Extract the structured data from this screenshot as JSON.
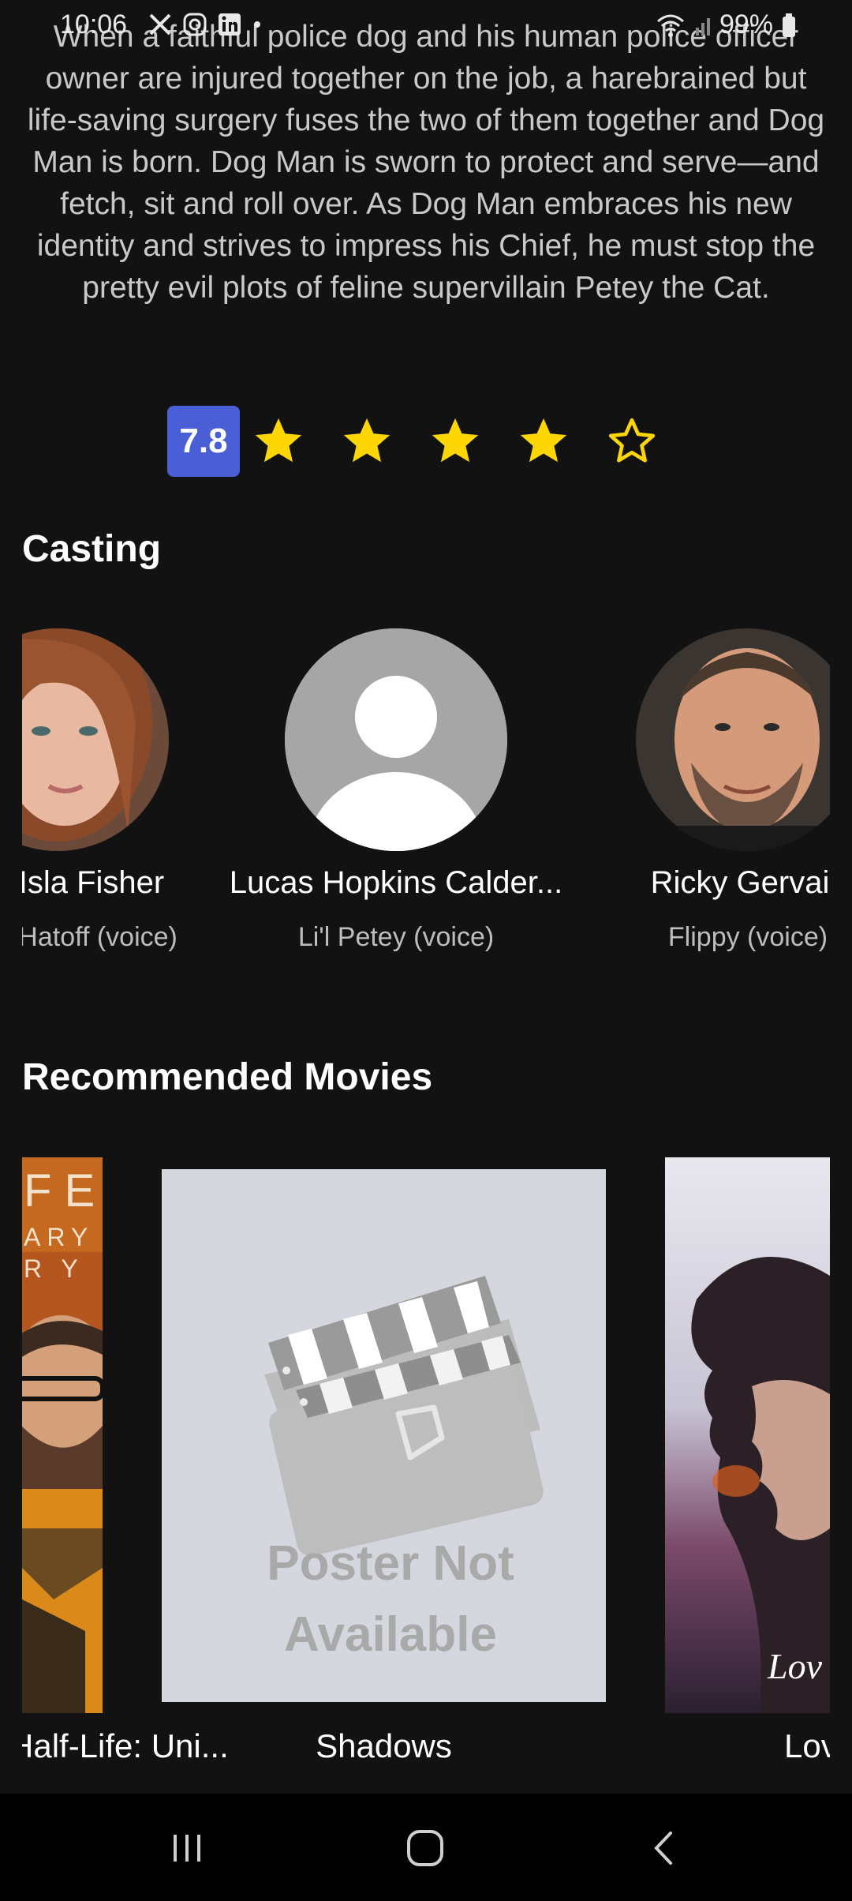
{
  "status_bar": {
    "time": "10:06",
    "battery": "99%",
    "icons": [
      "x-icon",
      "instagram-icon",
      "linkedin-icon",
      "dot-icon",
      "wifi-icon",
      "signal-icon",
      "battery-icon"
    ]
  },
  "movie": {
    "synopsis": "When a faithful police dog and his human police officer owner are injured together on the job, a harebrained but life-saving surgery fuses the two of them together and Dog Man is born. Dog Man is sworn to protect and serve—and fetch, sit and roll over. As Dog Man embraces his new identity and strives to impress his Chief, he must stop the pretty evil plots of feline supervillain Petey the Cat.",
    "rating": "7.8",
    "stars_filled": 4,
    "stars_total": 5,
    "star_color": "#FFD600",
    "badge_color": "#4A5FD6"
  },
  "casting": {
    "title": "Casting",
    "members": [
      {
        "name": "Isla Fisher",
        "role": "Sarah Hatoff (voice)"
      },
      {
        "name": "Lucas Hopkins Calder...",
        "role": "Li'l Petey (voice)"
      },
      {
        "name": "Ricky Gervais",
        "role": "Flippy (voice)"
      }
    ]
  },
  "recommended": {
    "title": "Recommended Movies",
    "movies": [
      {
        "title": "Half-Life: Uni..."
      },
      {
        "title": "Shadows",
        "poster_text_line1": "Poster Not",
        "poster_text_line2": "Available"
      },
      {
        "title": "Love"
      }
    ]
  }
}
